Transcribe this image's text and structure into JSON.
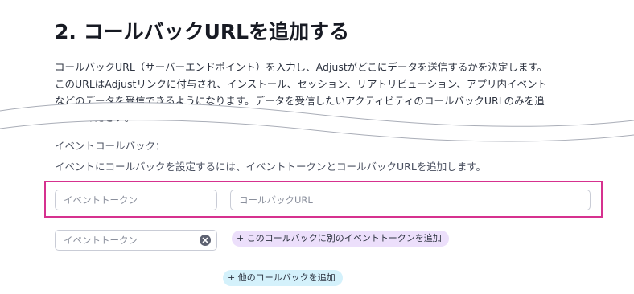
{
  "heading": "2. コールバックURLを追加する",
  "paragraph": {
    "line1": "コールバックURL（サーバーエンドポイント）を入力し、Adjustがどこにデータを送信するかを決定します。",
    "line2": "このURLはAdjustリンクに付与され、インストール、セッション、リアトリビューション、アプリ内イベント",
    "line3": "などのデータを受信できるようになります。データを受信したいアクティビティのコールバックURLのみを追",
    "line4": "加してください。"
  },
  "events_section": {
    "label": "イベントコールバック：",
    "description": "イベントにコールバックを設定するには、イベントトークンとコールバックURLを追加します。"
  },
  "inputs": {
    "event_token_placeholder": "イベントトークン",
    "callback_url_placeholder": "コールバックURL",
    "event_token_2_placeholder": "イベントトークン"
  },
  "buttons": {
    "add_event_token": "+ このコールバックに別のイベントトークンを追加",
    "add_callback": "+ 他のコールバックを追加"
  },
  "colors": {
    "highlight_border": "#d6318f",
    "pill_purple": "#ecdffb",
    "pill_cyan": "#d4f1fb"
  },
  "icons": {
    "clear": "x-circle-icon"
  }
}
